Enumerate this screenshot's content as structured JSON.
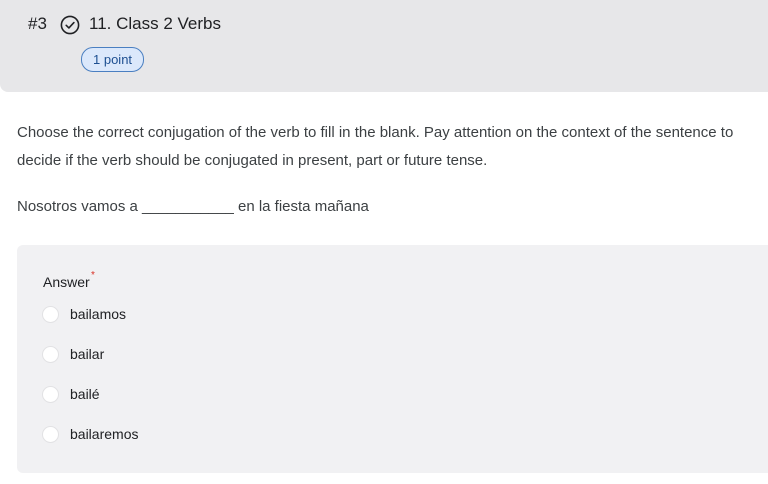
{
  "question": {
    "number": "#3",
    "title": "11. Class 2 Verbs",
    "points": "1 point",
    "status_icon": "check-circle-icon",
    "instructions": "Choose the correct conjugation of the verb to fill in the blank.  Pay attention on the context of the sentence to decide if the verb should be conjugated in present, part or future tense.",
    "sentence": "Nosotros vamos a ___________  en la fiesta mañana"
  },
  "answer": {
    "label": "Answer",
    "required_mark": "*",
    "options": [
      {
        "label": "bailamos"
      },
      {
        "label": "bailar"
      },
      {
        "label": "bailé"
      },
      {
        "label": "bailaremos"
      }
    ]
  },
  "colors": {
    "header_bg": "#e7e7e9",
    "badge_bg": "#dbe8fb",
    "badge_border": "#4a7fc1",
    "answer_panel_bg": "#f1f1f3",
    "required": "#d93025"
  }
}
